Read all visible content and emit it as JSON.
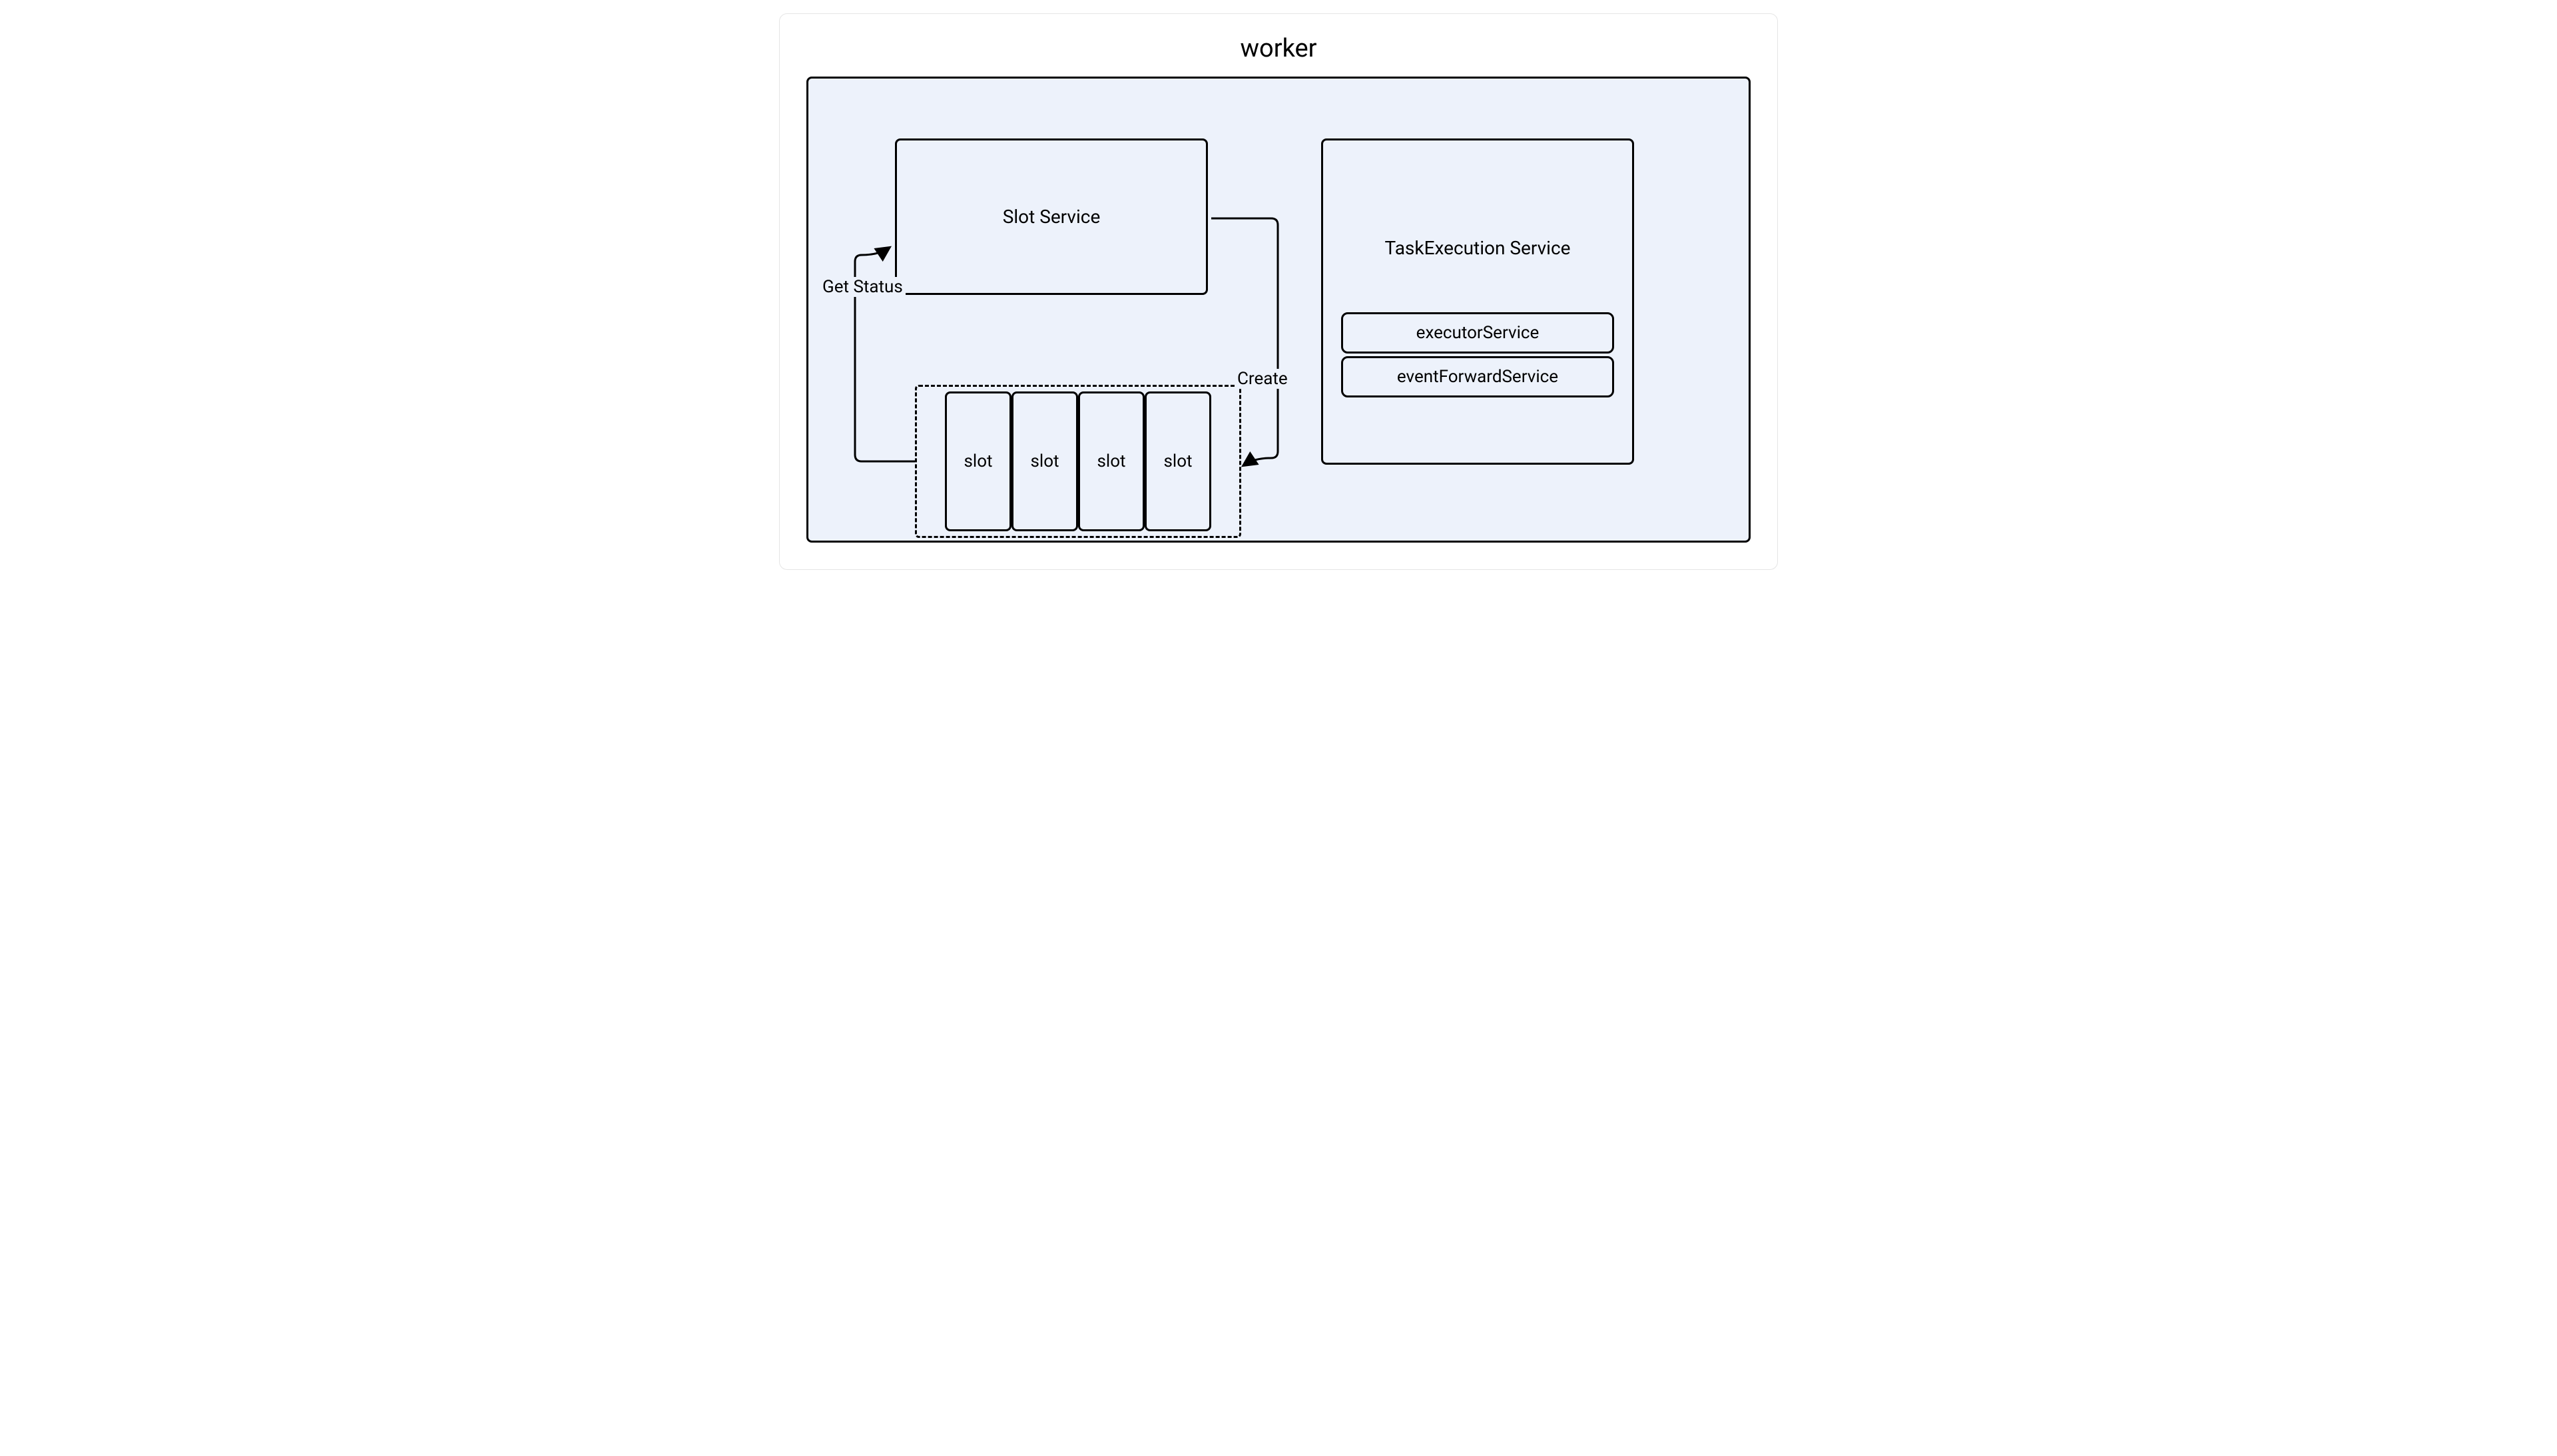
{
  "title": "worker",
  "slot_service_label": "Slot Service",
  "task_execution_label": "TaskExecution Service",
  "executor_service_label": "executorService",
  "event_forward_service_label": "eventForwardService",
  "slots": [
    "slot",
    "slot",
    "slot",
    "slot"
  ],
  "get_status_label": "Get Status",
  "create_label": "Create"
}
